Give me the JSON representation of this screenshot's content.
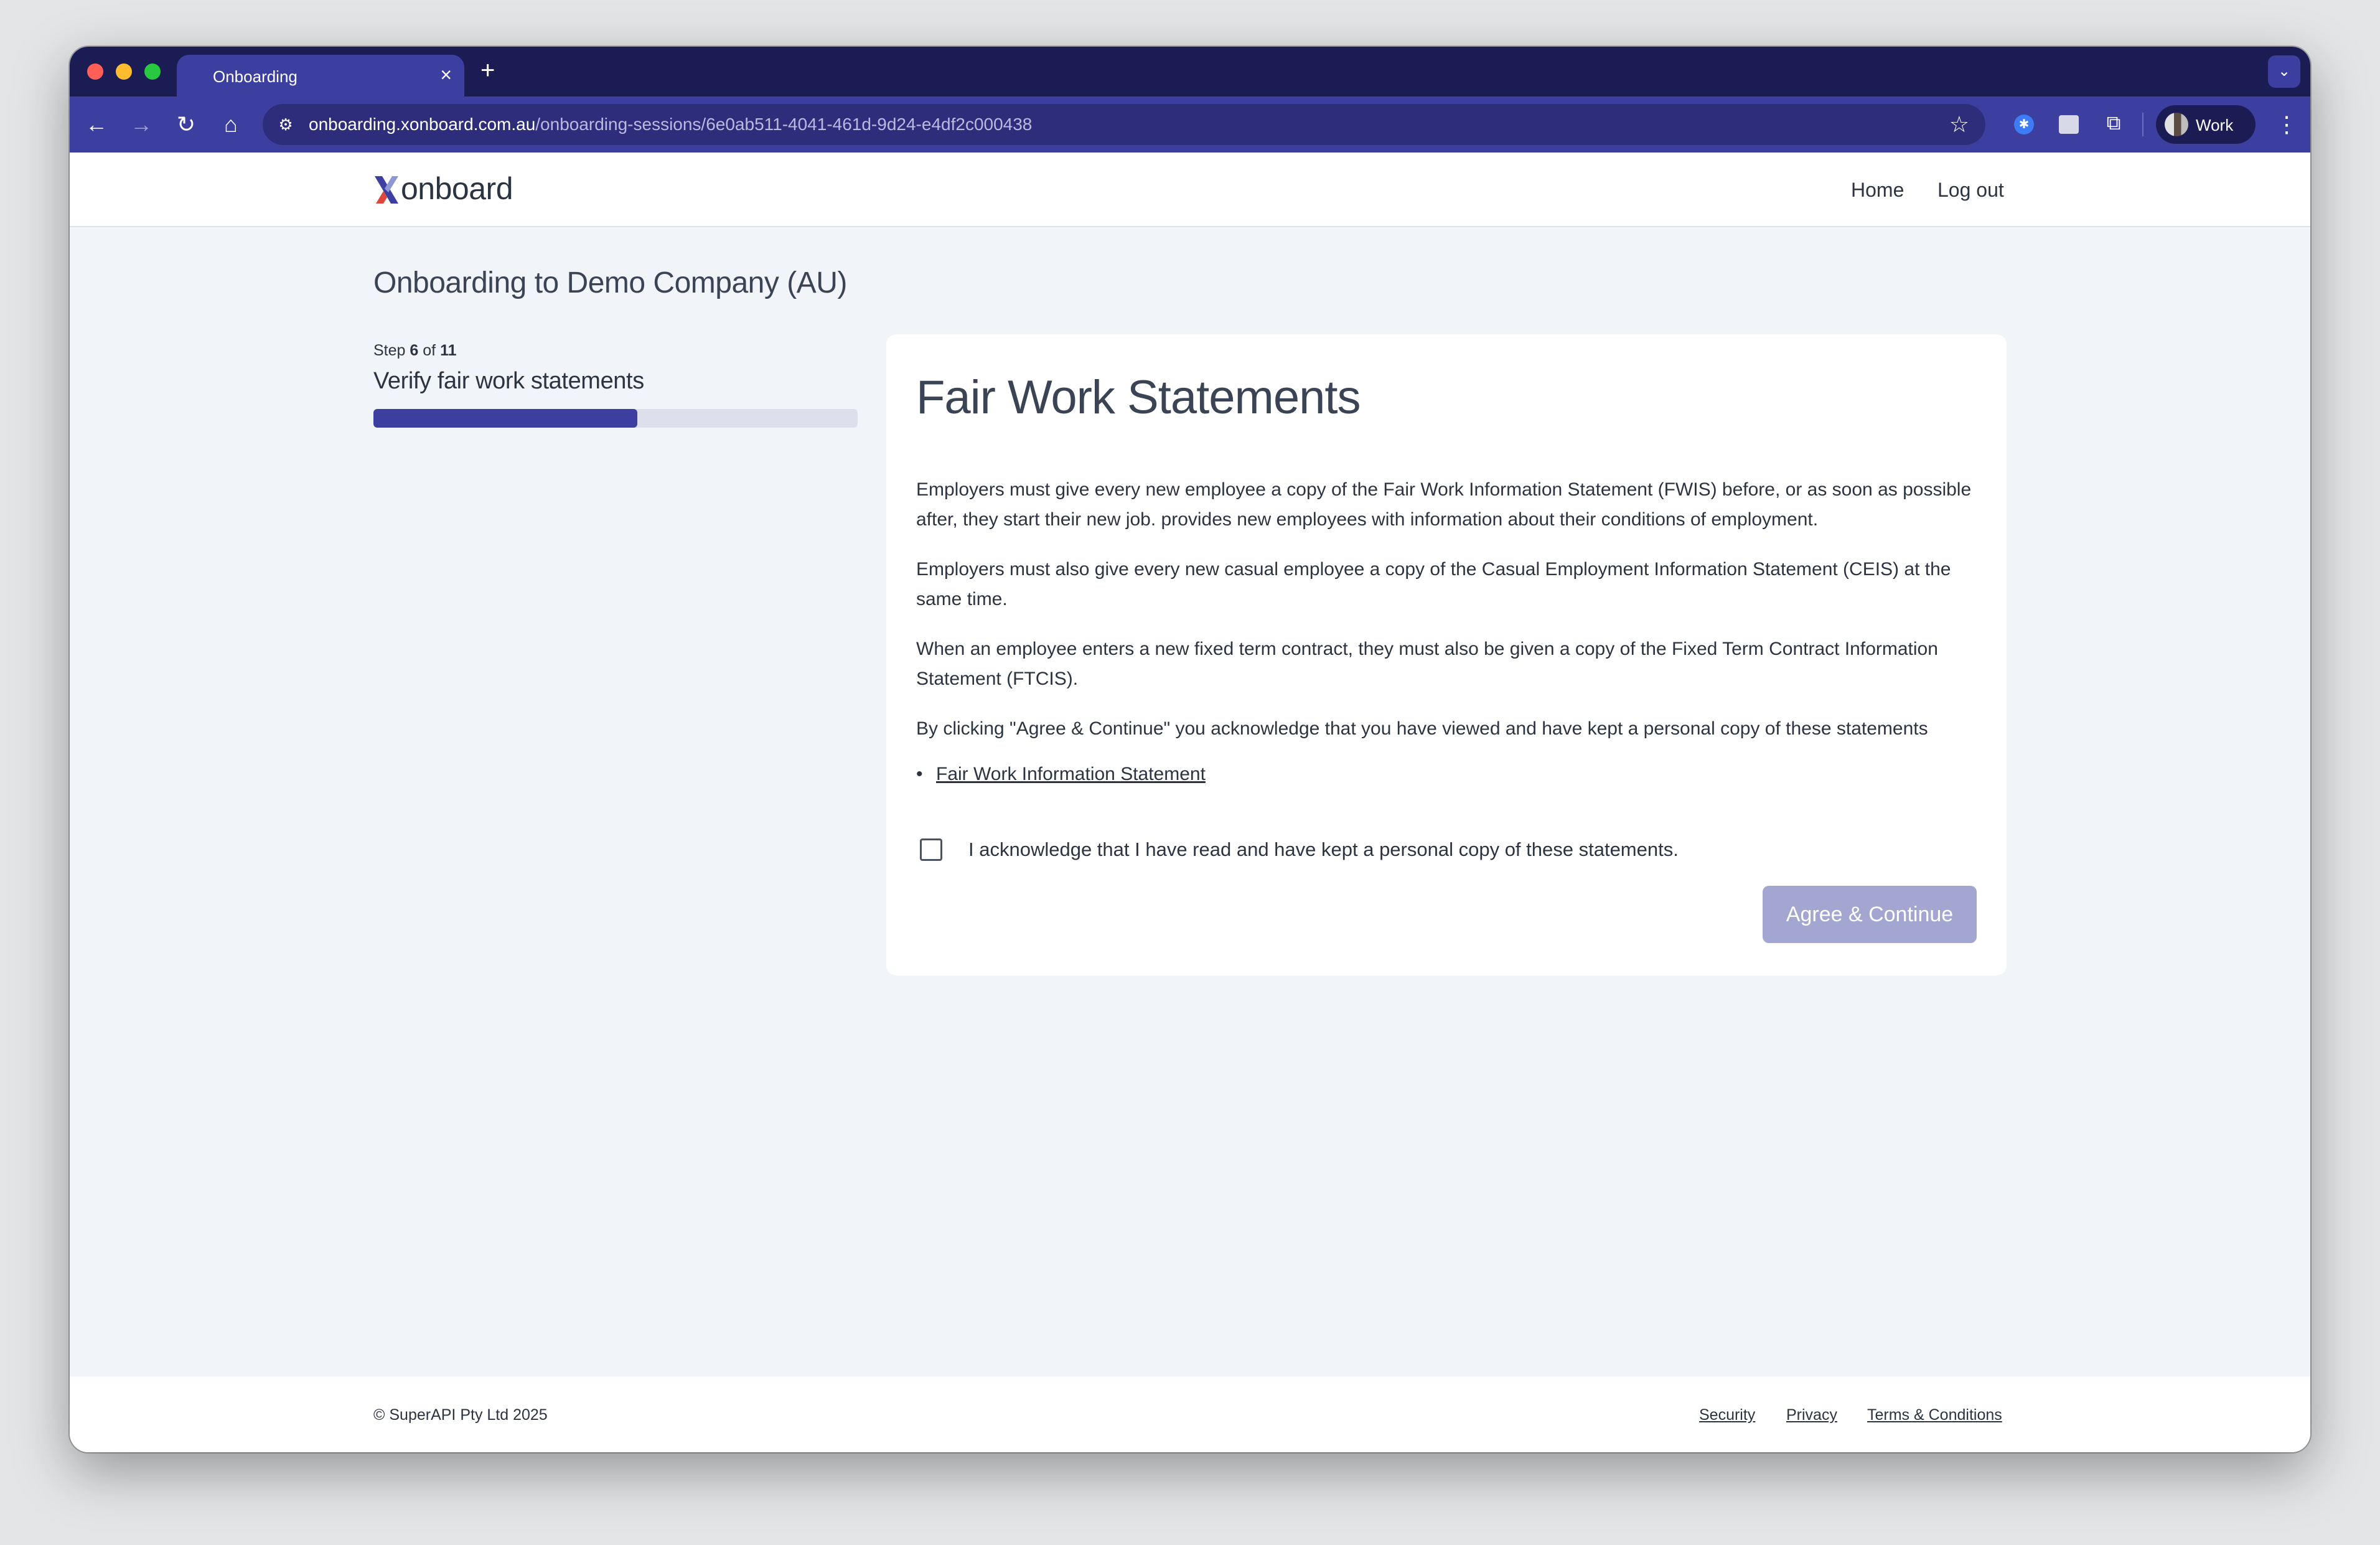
{
  "browser": {
    "tab_title": "Onboarding",
    "tab_close": "×",
    "new_tab": "+",
    "url_host": "onboarding.xonboard.com.au",
    "url_path": "/onboarding-sessions/6e0ab511-4041-461d-9d24-e4df2c000438",
    "profile_label": "Work"
  },
  "header": {
    "logo_text": "onboard",
    "nav": {
      "home": "Home",
      "logout": "Log out"
    }
  },
  "page": {
    "title": "Onboarding to Demo Company (AU)"
  },
  "progress": {
    "step_prefix": "Step",
    "step_current": "6",
    "step_of": "of",
    "step_total": "11",
    "step_title": "Verify fair work statements",
    "fraction": 0.545
  },
  "card": {
    "title": "Fair Work Statements",
    "paragraphs": [
      "Employers must give every new employee a copy of the Fair Work Information Statement (FWIS) before, or as soon as possible after, they start their new job. provides new employees with information about their conditions of employment.",
      "Employers must also give every new casual employee a copy of the Casual Employment Information Statement (CEIS) at the same time.",
      "When an employee enters a new fixed term contract, they must also be given a copy of the Fixed Term Contract Information Statement (FTCIS).",
      "By clicking \"Agree & Continue\" you acknowledge that you have viewed and have kept a personal copy of these statements"
    ],
    "documents": [
      {
        "label": "Fair Work Information Statement"
      }
    ],
    "acknowledge_label": "I acknowledge that I have read and have kept a personal copy of these statements.",
    "submit_label": "Agree & Continue"
  },
  "footer": {
    "copyright": "© SuperAPI Pty Ltd 2025",
    "links": {
      "security": "Security",
      "privacy": "Privacy",
      "terms": "Terms & Conditions"
    }
  },
  "colors": {
    "brand": "#3d3fa0",
    "brand_dark": "#1c1c55",
    "button_disabled": "#a2a6d1",
    "page_bg": "#f1f4f9"
  }
}
